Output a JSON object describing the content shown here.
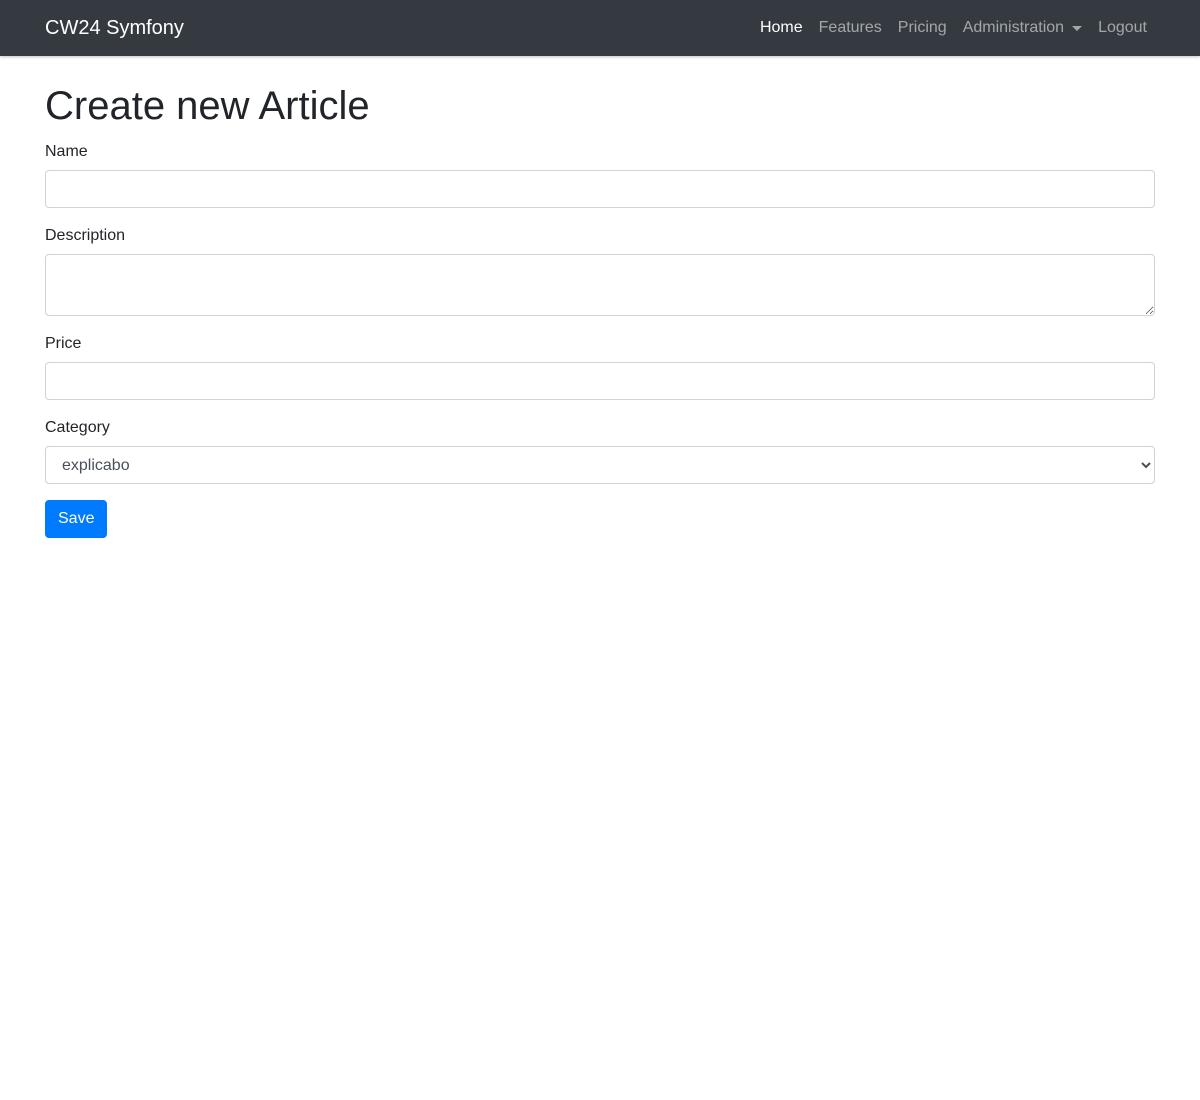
{
  "navbar": {
    "brand": "CW24 Symfony",
    "links": [
      {
        "label": "Home"
      },
      {
        "label": "Features"
      },
      {
        "label": "Pricing"
      },
      {
        "label": "Administration"
      },
      {
        "label": "Logout"
      }
    ]
  },
  "page": {
    "title": "Create new Article"
  },
  "form": {
    "name": {
      "label": "Name",
      "value": ""
    },
    "description": {
      "label": "Description",
      "value": ""
    },
    "price": {
      "label": "Price",
      "value": ""
    },
    "category": {
      "label": "Category",
      "selected": "explicabo"
    },
    "save_label": "Save"
  },
  "colors": {
    "navbar_bg": "#343a40",
    "primary": "#007bff"
  }
}
